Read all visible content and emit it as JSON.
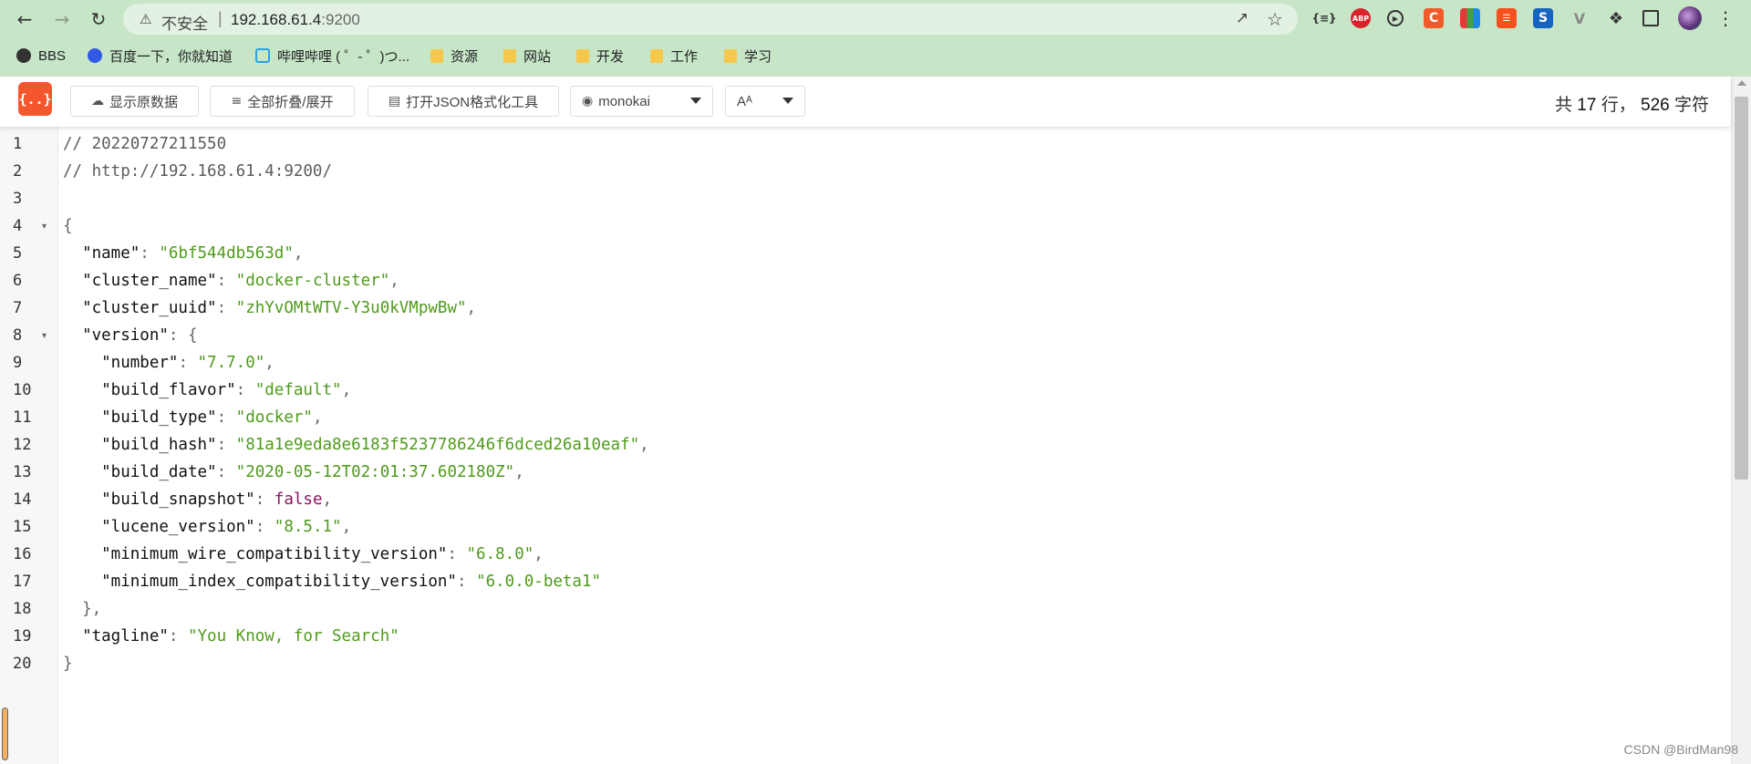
{
  "browser": {
    "security_label": "不安全",
    "url_host": "192.168.61.4",
    "url_port": ":9200",
    "extension_labels": {
      "json": "{≡}",
      "abp": "ABP",
      "c": "C",
      "s": "S",
      "v": "V"
    },
    "bookmarks": [
      {
        "label": "BBS",
        "icon": "globe-icon"
      },
      {
        "label": "百度一下，你就知道",
        "icon": "baidu-paw-icon"
      },
      {
        "label": "哔哩哔哩 ( ゜- ゜)つ...",
        "icon": "bilibili-tv-icon"
      },
      {
        "label": "资源",
        "icon": "folder-icon"
      },
      {
        "label": "网站",
        "icon": "folder-icon"
      },
      {
        "label": "开发",
        "icon": "folder-icon"
      },
      {
        "label": "工作",
        "icon": "folder-icon"
      },
      {
        "label": "学习",
        "icon": "folder-icon"
      }
    ]
  },
  "viewer": {
    "logo_text": "{..}",
    "raw_button": "显示原数据",
    "fold_button": "全部折叠/展开",
    "format_button": "打开JSON格式化工具",
    "theme_selected": "monokai",
    "font_selected": "Aᴬ",
    "stats": {
      "prefix": "共",
      "lines": "17",
      "lines_unit": "行，",
      "chars": "526",
      "chars_unit": "字符"
    },
    "accent_color": "#f4572e"
  },
  "code": {
    "line_numbers": [
      "1",
      "2",
      "3",
      "4",
      "5",
      "6",
      "7",
      "8",
      "9",
      "10",
      "11",
      "12",
      "13",
      "14",
      "15",
      "16",
      "17",
      "18",
      "19",
      "20"
    ],
    "lines": [
      {
        "parts": [
          {
            "t": "// 20220727211550",
            "c": "comment"
          }
        ]
      },
      {
        "parts": [
          {
            "t": "// http://192.168.61.4:9200/",
            "c": "comment"
          }
        ]
      },
      {
        "parts": []
      },
      {
        "parts": [
          {
            "t": "{",
            "c": "punct"
          }
        ]
      },
      {
        "parts": [
          {
            "t": "  \"name\"",
            "c": "key"
          },
          {
            "t": ": ",
            "c": "punct"
          },
          {
            "t": "\"6bf544db563d\"",
            "c": "str"
          },
          {
            "t": ",",
            "c": "punct"
          }
        ]
      },
      {
        "parts": [
          {
            "t": "  \"cluster_name\"",
            "c": "key"
          },
          {
            "t": ": ",
            "c": "punct"
          },
          {
            "t": "\"docker-cluster\"",
            "c": "str"
          },
          {
            "t": ",",
            "c": "punct"
          }
        ]
      },
      {
        "parts": [
          {
            "t": "  \"cluster_uuid\"",
            "c": "key"
          },
          {
            "t": ": ",
            "c": "punct"
          },
          {
            "t": "\"zhYvOMtWTV-Y3u0kVMpwBw\"",
            "c": "str"
          },
          {
            "t": ",",
            "c": "punct"
          }
        ]
      },
      {
        "parts": [
          {
            "t": "  \"version\"",
            "c": "key"
          },
          {
            "t": ": {",
            "c": "punct"
          }
        ]
      },
      {
        "parts": [
          {
            "t": "    \"number\"",
            "c": "key"
          },
          {
            "t": ": ",
            "c": "punct"
          },
          {
            "t": "\"7.7.0\"",
            "c": "str"
          },
          {
            "t": ",",
            "c": "punct"
          }
        ]
      },
      {
        "parts": [
          {
            "t": "    \"build_flavor\"",
            "c": "key"
          },
          {
            "t": ": ",
            "c": "punct"
          },
          {
            "t": "\"default\"",
            "c": "str"
          },
          {
            "t": ",",
            "c": "punct"
          }
        ]
      },
      {
        "parts": [
          {
            "t": "    \"build_type\"",
            "c": "key"
          },
          {
            "t": ": ",
            "c": "punct"
          },
          {
            "t": "\"docker\"",
            "c": "str"
          },
          {
            "t": ",",
            "c": "punct"
          }
        ]
      },
      {
        "parts": [
          {
            "t": "    \"build_hash\"",
            "c": "key"
          },
          {
            "t": ": ",
            "c": "punct"
          },
          {
            "t": "\"81a1e9eda8e6183f5237786246f6dced26a10eaf\"",
            "c": "str"
          },
          {
            "t": ",",
            "c": "punct"
          }
        ]
      },
      {
        "parts": [
          {
            "t": "    \"build_date\"",
            "c": "key"
          },
          {
            "t": ": ",
            "c": "punct"
          },
          {
            "t": "\"2020-05-12T02:01:37.602180Z\"",
            "c": "str"
          },
          {
            "t": ",",
            "c": "punct"
          }
        ]
      },
      {
        "parts": [
          {
            "t": "    \"build_snapshot\"",
            "c": "key"
          },
          {
            "t": ": ",
            "c": "punct"
          },
          {
            "t": "false",
            "c": "bool"
          },
          {
            "t": ",",
            "c": "punct"
          }
        ]
      },
      {
        "parts": [
          {
            "t": "    \"lucene_version\"",
            "c": "key"
          },
          {
            "t": ": ",
            "c": "punct"
          },
          {
            "t": "\"8.5.1\"",
            "c": "str"
          },
          {
            "t": ",",
            "c": "punct"
          }
        ]
      },
      {
        "parts": [
          {
            "t": "    \"minimum_wire_compatibility_version\"",
            "c": "key"
          },
          {
            "t": ": ",
            "c": "punct"
          },
          {
            "t": "\"6.8.0\"",
            "c": "str"
          },
          {
            "t": ",",
            "c": "punct"
          }
        ]
      },
      {
        "parts": [
          {
            "t": "    \"minimum_index_compatibility_version\"",
            "c": "key"
          },
          {
            "t": ": ",
            "c": "punct"
          },
          {
            "t": "\"6.0.0-beta1\"",
            "c": "str"
          }
        ]
      },
      {
        "parts": [
          {
            "t": "  },",
            "c": "punct"
          }
        ]
      },
      {
        "parts": [
          {
            "t": "  \"tagline\"",
            "c": "key"
          },
          {
            "t": ": ",
            "c": "punct"
          },
          {
            "t": "\"You Know, for Search\"",
            "c": "str"
          }
        ]
      },
      {
        "parts": [
          {
            "t": "}",
            "c": "punct"
          }
        ]
      }
    ],
    "fold_lines": [
      "4",
      "8"
    ]
  },
  "watermark": "CSDN @BirdMan98"
}
